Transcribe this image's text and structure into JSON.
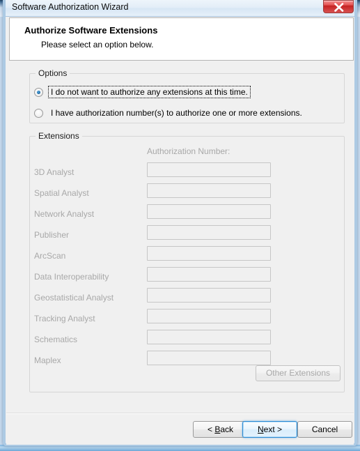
{
  "window": {
    "title": "Software Authorization Wizard",
    "close_icon": "close-icon",
    "close_label": "Close"
  },
  "header": {
    "title": "Authorize Software Extensions",
    "subtitle": "Please select an option below."
  },
  "options_group": {
    "legend": "Options",
    "radios": [
      {
        "label": "I do not want to authorize any extensions at this time.",
        "selected": true,
        "focused": true
      },
      {
        "label": "I have authorization number(s) to authorize one or more extensions.",
        "selected": false,
        "focused": false
      }
    ]
  },
  "extensions_group": {
    "legend": "Extensions",
    "column_header": "Authorization Number:",
    "disabled": true,
    "rows": [
      {
        "name": "3D Analyst",
        "value": ""
      },
      {
        "name": "Spatial Analyst",
        "value": ""
      },
      {
        "name": "Network Analyst",
        "value": ""
      },
      {
        "name": "Publisher",
        "value": ""
      },
      {
        "name": "ArcScan",
        "value": ""
      },
      {
        "name": "Data Interoperability",
        "value": ""
      },
      {
        "name": "Geostatistical Analyst",
        "value": ""
      },
      {
        "name": "Tracking Analyst",
        "value": ""
      },
      {
        "name": "Schematics",
        "value": ""
      },
      {
        "name": "Maplex",
        "value": ""
      }
    ],
    "other_extensions_label": "Other Extensions"
  },
  "footer": {
    "back_label": "< Back",
    "back_accel": "B",
    "next_label": "Next >",
    "next_accel": "N",
    "cancel_label": "Cancel",
    "default_button": "Next >"
  },
  "colors": {
    "dialog_background": "#f0f0f0",
    "header_background": "#ffffff",
    "disabled_text": "#a8a8a8",
    "default_button_accent": "#2a8ad4",
    "close_button_red": "#c52222",
    "radio_dot": "#1f6ea8"
  }
}
